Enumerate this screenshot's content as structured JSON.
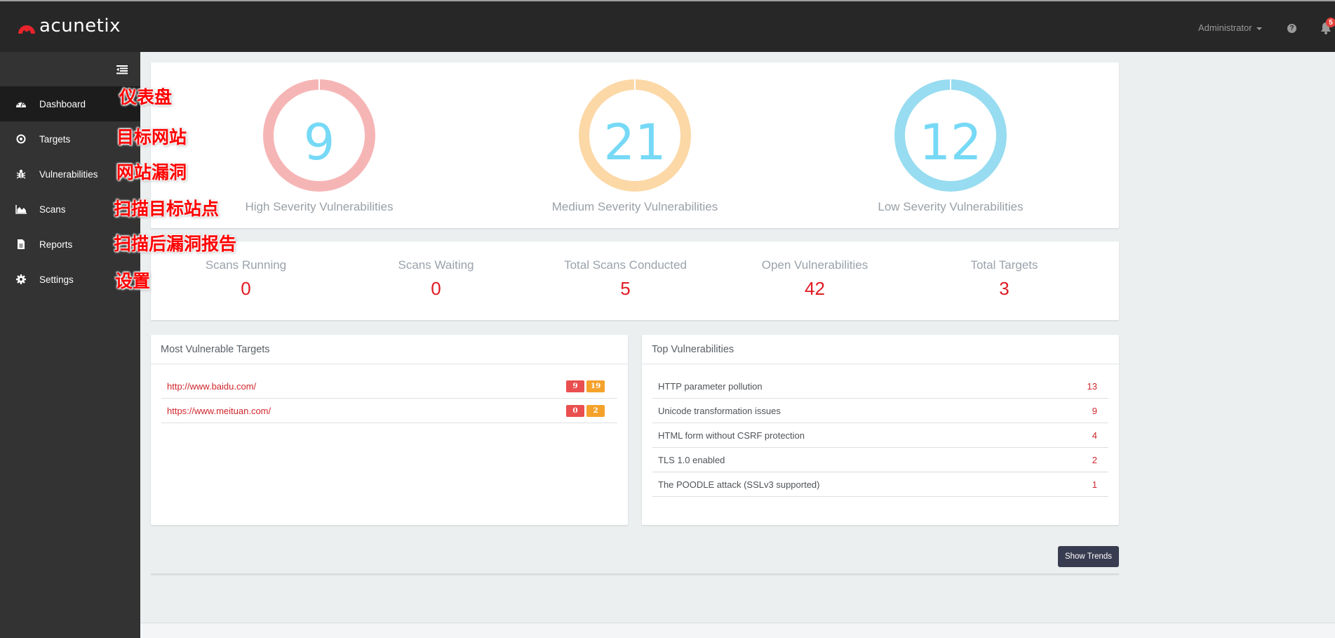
{
  "header": {
    "logo_text": "acunetix",
    "user_menu_label": "Administrator",
    "notifications_count": "5"
  },
  "sidebar": {
    "items": [
      {
        "label": "Dashboard",
        "icon": "dashboard-gauge-icon",
        "active": true
      },
      {
        "label": "Targets",
        "icon": "target-icon",
        "active": false
      },
      {
        "label": "Vulnerabilities",
        "icon": "bug-icon",
        "active": false
      },
      {
        "label": "Scans",
        "icon": "area-chart-icon",
        "active": false
      },
      {
        "label": "Reports",
        "icon": "document-icon",
        "active": false
      },
      {
        "label": "Settings",
        "icon": "gear-icon",
        "active": false
      }
    ]
  },
  "annotations": [
    "仪表盘",
    "目标网站",
    "网站漏洞",
    "扫描目标站点",
    "扫描后漏洞报告",
    "设置"
  ],
  "severity": [
    {
      "label": "High Severity Vulnerabilities",
      "value": "9",
      "ring_color": "#f6b5b5"
    },
    {
      "label": "Medium Severity Vulnerabilities",
      "value": "21",
      "ring_color": "#fcd8a6"
    },
    {
      "label": "Low Severity Vulnerabilities",
      "value": "12",
      "ring_color": "#97dcf0"
    }
  ],
  "stats": [
    {
      "label": "Scans Running",
      "value": "0"
    },
    {
      "label": "Scans Waiting",
      "value": "0"
    },
    {
      "label": "Total Scans Conducted",
      "value": "5"
    },
    {
      "label": "Open Vulnerabilities",
      "value": "42"
    },
    {
      "label": "Total Targets",
      "value": "3"
    }
  ],
  "most_vulnerable_targets": {
    "title": "Most Vulnerable Targets",
    "rows": [
      {
        "url": "http://www.baidu.com/",
        "high": "9",
        "medium": "19"
      },
      {
        "url": "https://www.meituan.com/",
        "high": "0",
        "medium": "2"
      }
    ]
  },
  "top_vulnerabilities": {
    "title": "Top Vulnerabilities",
    "rows": [
      {
        "name": "HTTP parameter pollution",
        "count": "13"
      },
      {
        "name": "Unicode transformation issues",
        "count": "9"
      },
      {
        "name": "HTML form without CSRF protection",
        "count": "4"
      },
      {
        "name": "TLS 1.0 enabled",
        "count": "2"
      },
      {
        "name": "The POODLE attack (SSLv3 supported)",
        "count": "1"
      }
    ]
  },
  "trends": {
    "button_label": "Show Trends"
  },
  "colors": {
    "accent_red": "#e01b22",
    "badge_high": "#ea4f4f",
    "badge_medium": "#f5a22b",
    "number_blue": "#76d9f6",
    "header_bg": "#272727",
    "sidebar_bg": "#333333"
  }
}
